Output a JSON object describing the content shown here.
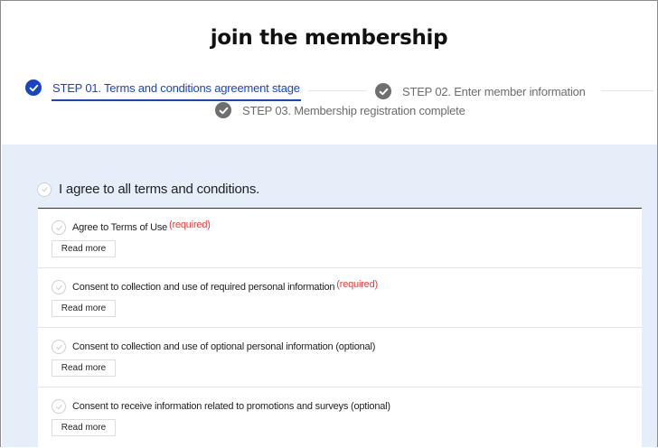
{
  "page": {
    "title": "join the membership"
  },
  "steps": [
    {
      "label": "STEP 01. Terms and conditions agreement stage",
      "state": "active"
    },
    {
      "label": "STEP 02. Enter member information",
      "state": "inactive"
    },
    {
      "label": "STEP 03. Membership registration complete",
      "state": "inactive"
    }
  ],
  "agree_all": {
    "label": "I agree to all terms and conditions.",
    "checked": false
  },
  "terms": [
    {
      "label": "Agree to Terms of Use",
      "tag": "(required)",
      "button": "Read more",
      "checked": false
    },
    {
      "label": "Consent to collection and use of required personal information",
      "tag": "(required)",
      "button": "Read more",
      "checked": false
    },
    {
      "label": "Consent to collection and use of optional personal information (optional)",
      "tag": "",
      "button": "Read more",
      "checked": false
    },
    {
      "label": "Consent to receive information related to promotions and surveys (optional)",
      "tag": "",
      "button": "Read more",
      "checked": false
    }
  ],
  "colors": {
    "accent": "#1a44c8",
    "required": "#e53a3a",
    "inactive_step": "#6f6f6f",
    "content_background": "#e6eff9"
  },
  "icons": {
    "step_status": "check-circle-icon",
    "checkbox": "check-circle-icon"
  }
}
